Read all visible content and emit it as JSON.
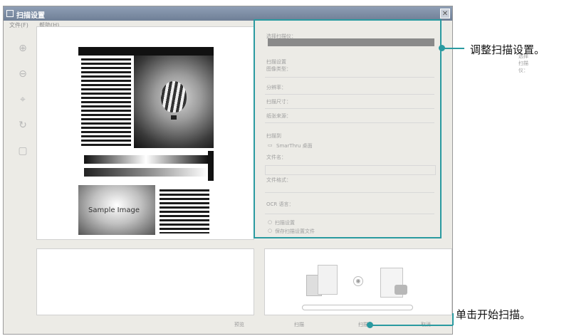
{
  "window": {
    "title": "扫描设置",
    "close_glyph": "✕"
  },
  "menu": {
    "items": [
      "文件(F)",
      "帮助(H)"
    ]
  },
  "toolbar": {
    "icons": [
      "zoom-in-icon",
      "zoom-out-icon",
      "select-icon",
      "rotate-icon",
      "save-icon"
    ]
  },
  "preview": {
    "sample_text": "Sample Image"
  },
  "settings": {
    "scanner_label": "选择扫描仪：",
    "scan_settings_label": "扫描设置",
    "image_type_label": "图像类型：",
    "resolution_label": "分辨率：",
    "scan_size_label": "扫描尺寸：",
    "source_label": "纸张来源：",
    "scan_to_label": "扫描到",
    "desktop_label": "SmarThru 桌面",
    "filename_label": "文件名：",
    "format_label": "文件格式：",
    "ocr_label": "OCR 语言：",
    "option1_label": "扫描设置",
    "option2_label": "保存扫描设置文件"
  },
  "buttons": {
    "labels": [
      "预览",
      "扫描",
      "扫描",
      "取消"
    ]
  },
  "callouts": {
    "top": "调整扫描设置。",
    "bottom": "单击开始扫描。"
  }
}
